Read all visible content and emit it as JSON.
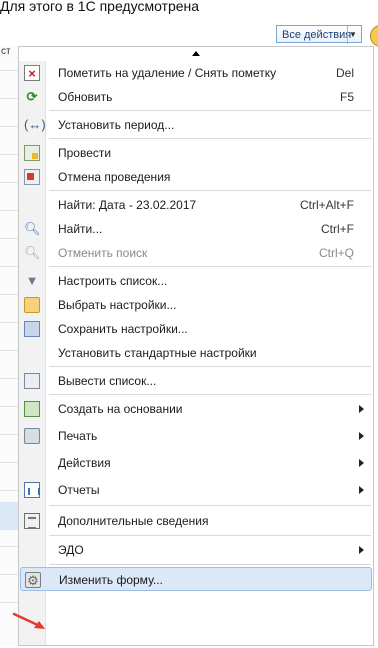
{
  "top_text": "Для этого в 1С предусмотрена",
  "left_strip": {
    "tag": "ст"
  },
  "toolbar": {
    "all_actions_label": "Все действия",
    "help_label": "?"
  },
  "menu": {
    "items": [
      {
        "label": "Пометить на удаление / Снять пометку",
        "shortcut": "Del",
        "icon": "delete-mark-icon"
      },
      {
        "label": "Обновить",
        "shortcut": "F5",
        "icon": "refresh-icon"
      },
      {
        "label": "Установить период...",
        "shortcut": "",
        "icon": "period-icon"
      },
      {
        "label": "Провести",
        "shortcut": "",
        "icon": "post-document-icon"
      },
      {
        "label": "Отмена проведения",
        "shortcut": "",
        "icon": "cancel-posting-icon"
      },
      {
        "label": "Найти: Дата - 23.02.2017",
        "shortcut": "Ctrl+Alt+F",
        "icon": ""
      },
      {
        "label": "Найти...",
        "shortcut": "Ctrl+F",
        "icon": "search-icon"
      },
      {
        "label": "Отменить поиск",
        "shortcut": "Ctrl+Q",
        "icon": "cancel-search-icon",
        "disabled": true
      },
      {
        "label": "Настроить список...",
        "shortcut": "",
        "icon": "filter-icon"
      },
      {
        "label": "Выбрать настройки...",
        "shortcut": "",
        "icon": "folder-icon"
      },
      {
        "label": "Сохранить настройки...",
        "shortcut": "",
        "icon": "save-settings-icon"
      },
      {
        "label": "Установить стандартные настройки",
        "shortcut": "",
        "icon": ""
      },
      {
        "label": "Вывести список...",
        "shortcut": "",
        "icon": "output-list-icon"
      },
      {
        "label": "Создать на основании",
        "shortcut": "",
        "icon": "create-based-icon",
        "submenu": true
      },
      {
        "label": "Печать",
        "shortcut": "",
        "icon": "printer-icon",
        "submenu": true
      },
      {
        "label": "Действия",
        "shortcut": "",
        "icon": "",
        "submenu": true
      },
      {
        "label": "Отчеты",
        "shortcut": "",
        "icon": "reports-icon",
        "submenu": true
      },
      {
        "label": "Дополнительные сведения",
        "shortcut": "",
        "icon": "additional-info-icon"
      },
      {
        "label": "ЭДО",
        "shortcut": "",
        "icon": "",
        "submenu": true
      },
      {
        "label": "Изменить форму...",
        "shortcut": "",
        "icon": "change-form-icon",
        "highlighted": true
      }
    ]
  },
  "colors": {
    "highlight_bg": "#dbe8f7",
    "highlight_border": "#9cbde4",
    "arrow": "#e5392b",
    "disabled_text": "#8a8a8a"
  }
}
